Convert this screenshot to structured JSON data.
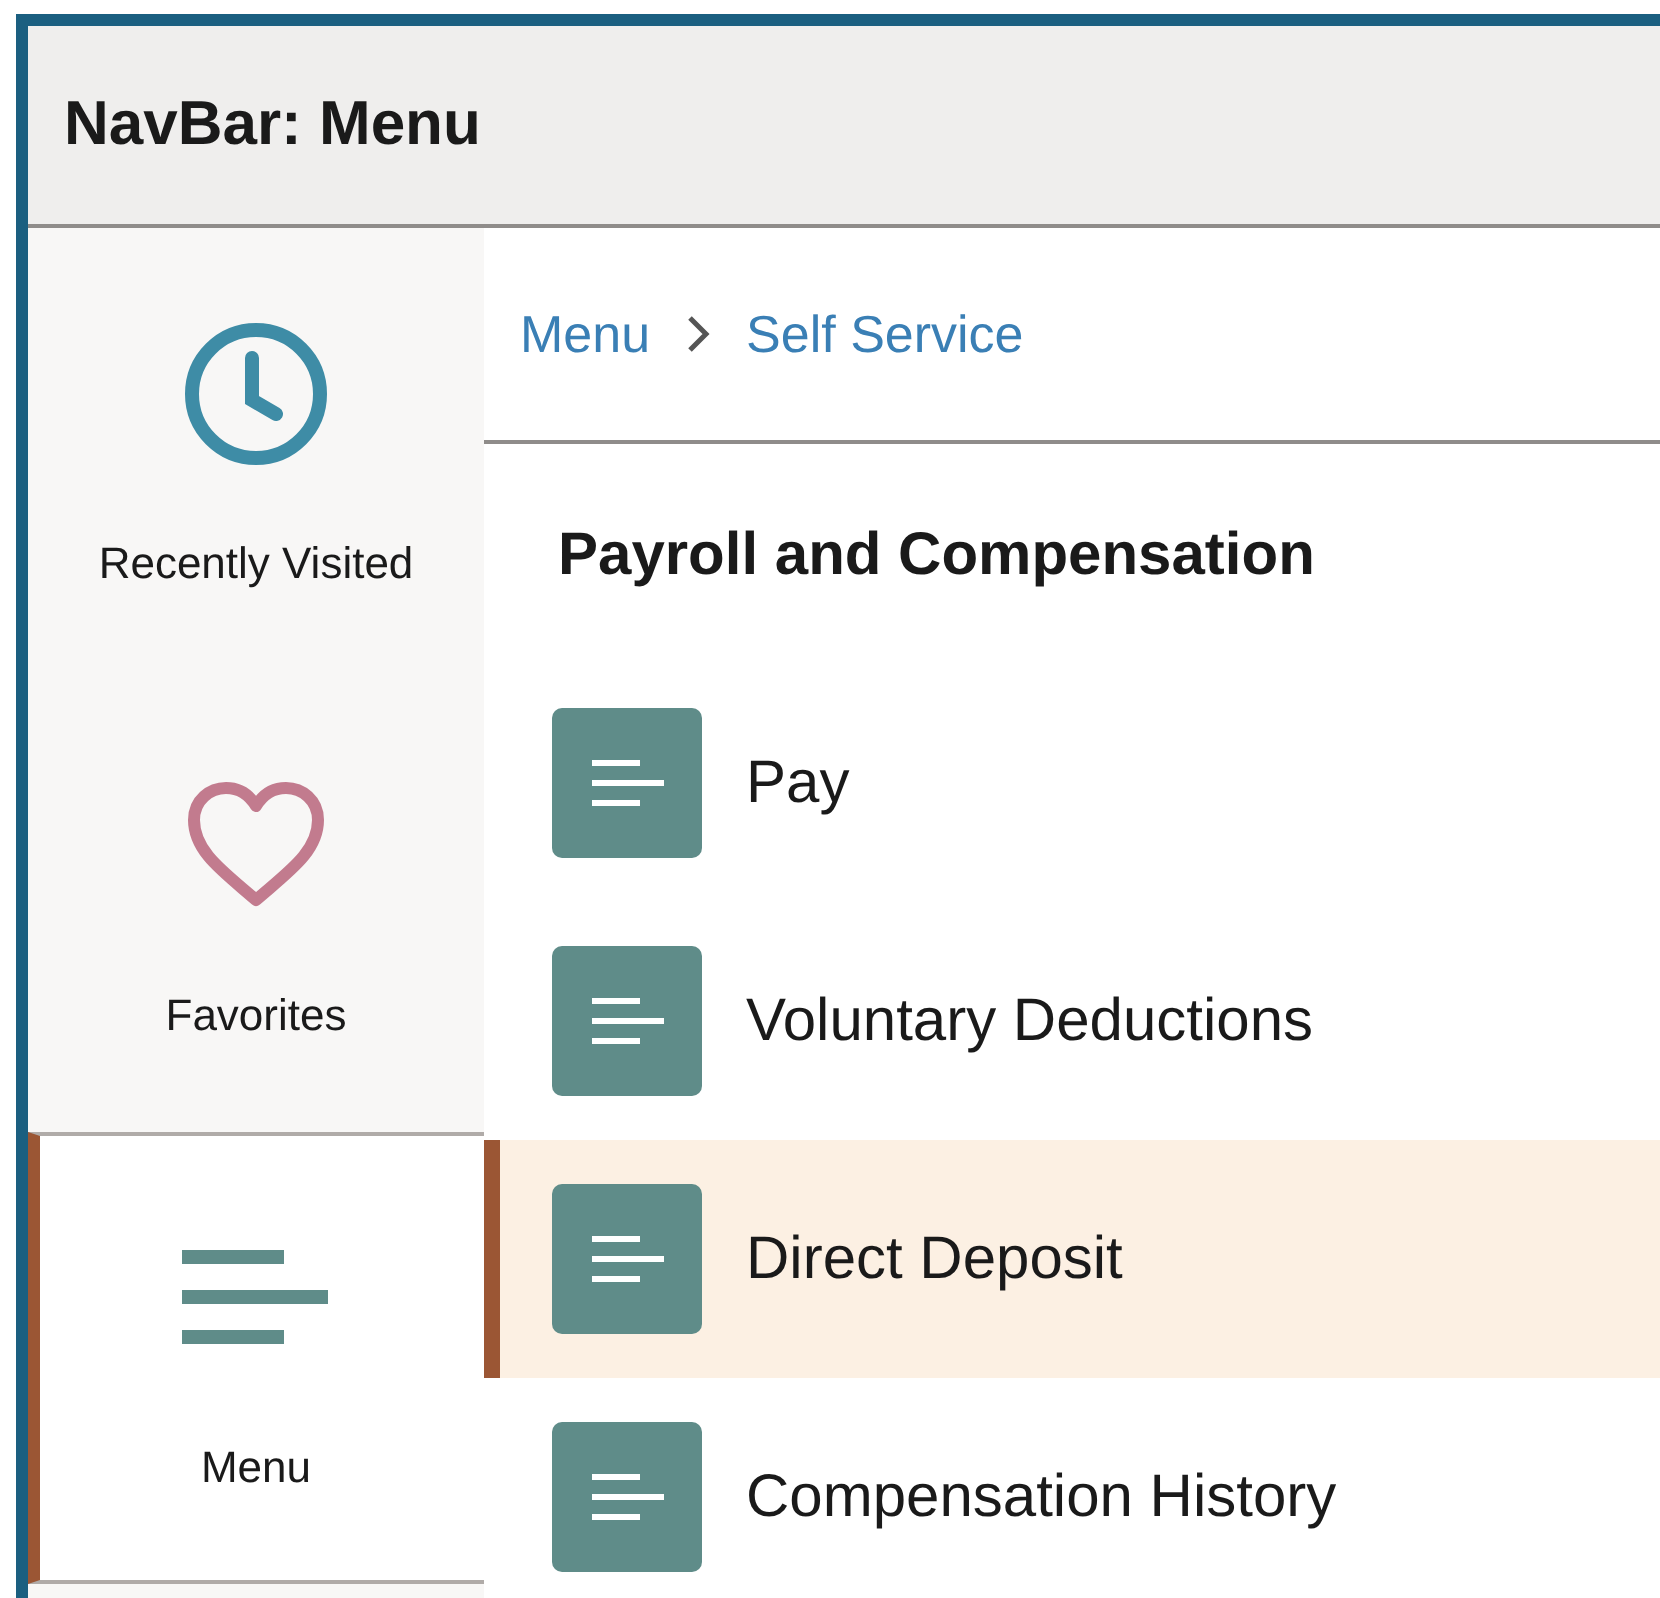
{
  "header": {
    "title": "NavBar: Menu"
  },
  "sidebar": {
    "items": [
      {
        "kind": "clock",
        "label": "Recently Visited",
        "selected": false
      },
      {
        "kind": "heart",
        "label": "Favorites",
        "selected": false
      },
      {
        "kind": "menu",
        "label": "Menu",
        "selected": true
      }
    ]
  },
  "breadcrumb": [
    "Menu",
    "Self Service"
  ],
  "section": {
    "title": "Payroll and Compensation",
    "items": [
      {
        "label": "Pay",
        "selected": false
      },
      {
        "label": "Voluntary Deductions",
        "selected": false
      },
      {
        "label": "Direct Deposit",
        "selected": true
      },
      {
        "label": "Compensation History",
        "selected": false
      }
    ]
  }
}
